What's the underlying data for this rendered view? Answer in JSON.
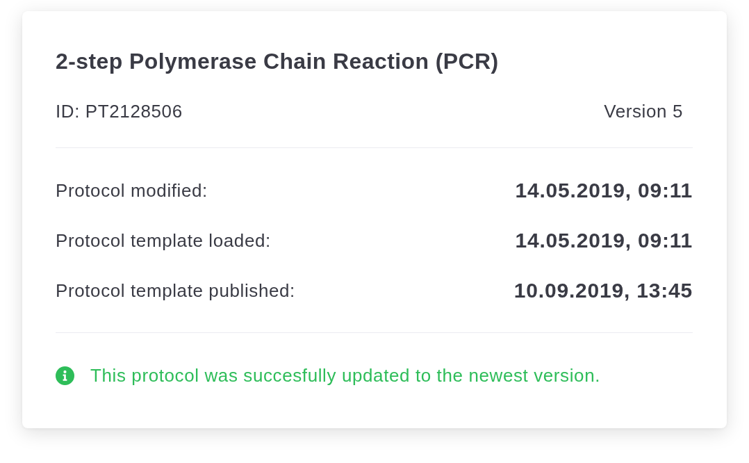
{
  "card": {
    "title": "2-step Polymerase Chain Reaction (PCR)",
    "id": "ID: PT2128506",
    "version": "Version 5"
  },
  "details": [
    {
      "label": "Protocol modified:",
      "value": "14.05.2019, 09:11"
    },
    {
      "label": "Protocol template loaded:",
      "value": "14.05.2019, 09:11"
    },
    {
      "label": "Protocol template published:",
      "value": "10.09.2019, 13:45"
    }
  ],
  "notice": {
    "kind": "success",
    "text": "This protocol was succesfully updated to the newest version."
  }
}
